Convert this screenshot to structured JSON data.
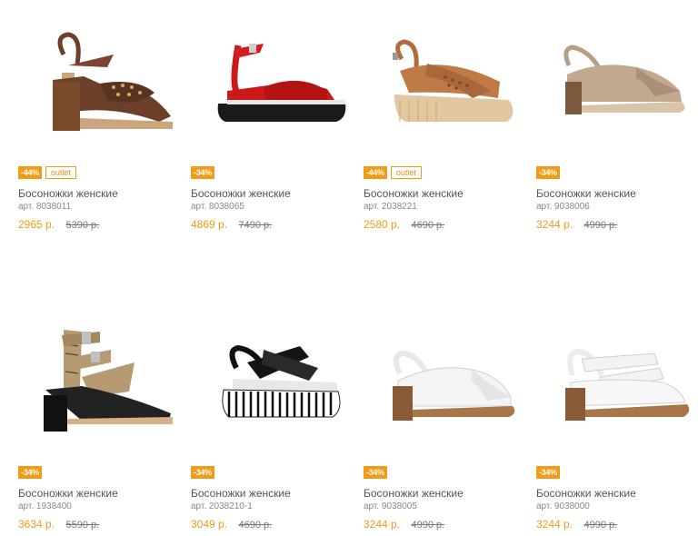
{
  "colors": {
    "accent": "#f29b14",
    "text": "#555555",
    "muted": "#888888"
  },
  "products": [
    {
      "title": "Босоножки женские",
      "article": "арт. 8038011",
      "discount": "-44%",
      "outlet": "outlet",
      "price": "2965 р.",
      "old_price": "5390 р.",
      "image": "brown-perforated-block-heel-sandal"
    },
    {
      "title": "Босоножки женские",
      "article": "арт. 8038065",
      "discount": "-34%",
      "price": "4869 р.",
      "old_price": "7490 р.",
      "image": "red-croc-platform-sandal"
    },
    {
      "title": "Босоножки женские",
      "article": "арт. 2038221",
      "discount": "-44%",
      "outlet": "outlet",
      "price": "2580 р.",
      "old_price": "4690 р.",
      "image": "tan-perforated-wedge-sandal"
    },
    {
      "title": "Босоножки женские",
      "article": "арт. 9038006",
      "discount": "-34%",
      "price": "3244 р.",
      "old_price": "4990 р.",
      "image": "beige-slingback-sandal"
    },
    {
      "title": "Босоножки женские",
      "article": "арт. 1938400",
      "discount": "-34%",
      "price": "3634 р.",
      "old_price": "5590 р.",
      "image": "snake-print-strappy-sandal"
    },
    {
      "title": "Босоножки женские",
      "article": "арт. 2038210-1",
      "discount": "-34%",
      "price": "3049 р.",
      "old_price": "4690 р.",
      "image": "black-patent-striped-wedge-sandal"
    },
    {
      "title": "Босоножки женские",
      "article": "арт. 9038005",
      "discount": "-34%",
      "price": "3244 р.",
      "old_price": "4990 р.",
      "image": "white-slingback-sandal"
    },
    {
      "title": "Босоножки женские",
      "article": "арт. 9038000",
      "discount": "-34%",
      "price": "3244 р.",
      "old_price": "4990 р.",
      "image": "white-velcro-strap-sandal"
    }
  ]
}
